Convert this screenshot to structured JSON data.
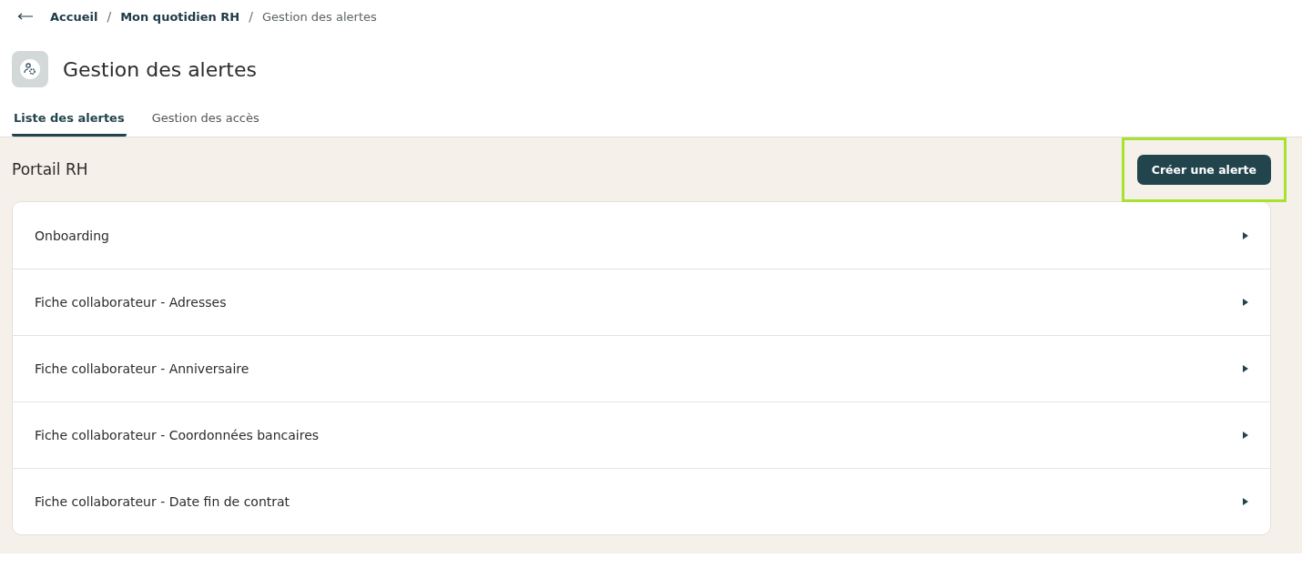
{
  "breadcrumb": [
    {
      "label": "Accueil",
      "current": false
    },
    {
      "label": "Mon quotidien RH",
      "current": false,
      "separator": "/"
    },
    {
      "label": "Gestion des alertes",
      "current": true,
      "separator": "/"
    }
  ],
  "page": {
    "title": "Gestion des alertes"
  },
  "tabs": [
    {
      "label": "Liste des alertes",
      "selected": true
    },
    {
      "label": "Gestion des accès",
      "selected": false
    }
  ],
  "section": {
    "title": "Portail RH",
    "create_button": {
      "label": "Créer une alerte",
      "highlighted": true
    }
  },
  "alerts": [
    {
      "label": "Onboarding"
    },
    {
      "label": "Fiche collaborateur - Adresses"
    },
    {
      "label": "Fiche collaborateur - Anniversaire"
    },
    {
      "label": "Fiche collaborateur - Coordonnées bancaires"
    },
    {
      "label": "Fiche collaborateur - Date fin de contrat"
    }
  ]
}
